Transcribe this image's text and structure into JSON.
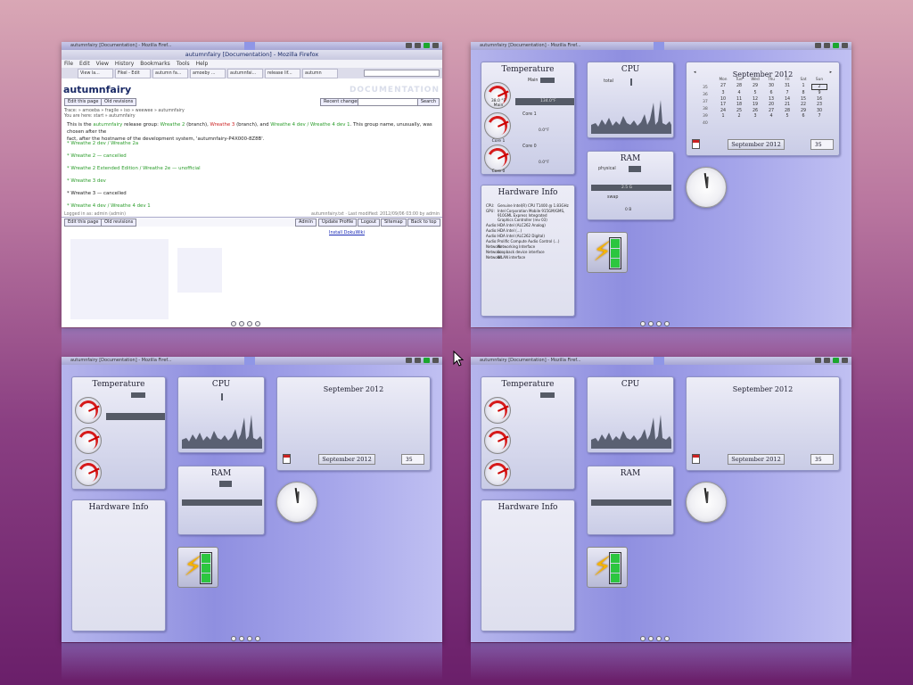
{
  "firefox": {
    "panel_title": "autumnfairy [Documentation] - Mozilla Firef...",
    "window_title": "autumnfairy [Documentation] - Mozilla Firefox",
    "menu": [
      "File",
      "Edit",
      "View",
      "History",
      "Bookmarks",
      "Tools",
      "Help"
    ],
    "tabs": [
      "View la...",
      "Fikel - Edit",
      "autumn fa...",
      "amoeby ...",
      "autumnfai...",
      "release lif...",
      "autumn"
    ],
    "logo": "autumnfairy",
    "doc_label": "DOCUMENTATION",
    "buttons": {
      "edit_page": "Edit this page",
      "old_revisions": "Old revisions",
      "recent_changes": "Recent changes",
      "search": "Search"
    },
    "trail": "Trace: » amoeba » fragile » iso » weewee » autumnfairy",
    "location": "You are here: start » autumnfairy",
    "intro_prefix": "This is the",
    "intro_link": "autumnfairy",
    "intro_mid": "release group:",
    "g1": "Wreathe 2",
    "g1_tail": "(branch),",
    "g2": "Wreathe 3",
    "g2_tail": "(branch), and",
    "g3": "Wreathe 4 dev / Wreathe 4 dev 1",
    "intro_end": ". This group name, unusually, was chosen after the",
    "intro_line2": "fact, after the hostname of the development system, 'autumnfairy-P4X000-8Z8B'.",
    "bullets": [
      "Wreathe 2 dev / Wreathe 2a",
      "Wreathe 2 — cancelled",
      "Wreathe 2 Extended Edition / Wreathe 2e — unofficial",
      "Wreathe 3 dev",
      "Wreathe 3 — cancelled",
      "Wreathe 4 dev / Wreathe 4 dev 1"
    ],
    "footer_left": "Logged in as: admin (admin)",
    "footer_right": "autumnfairy.txt · Last modified: 2012/09/06 03:00 by admin",
    "footer_buttons": [
      "Admin",
      "Update Profile",
      "Logout",
      "Sitemap",
      "Back to top"
    ],
    "footer_edit": "Edit this page",
    "footer_old": "Old revisions",
    "install": "Install DokuWiki"
  },
  "desktop": {
    "panel_title": "autumnfairy [Documentation] - Mozilla Firef...",
    "temperature": {
      "title": "Temperature",
      "main_label": "Main",
      "core1_label": "Core 1",
      "core0_label": "Core 0",
      "gauge1_value": "38.0 °F",
      "gauge1_label": "Main",
      "gauge2_label": "Core 1",
      "gauge3_label": "Core 0",
      "reading_main": "134.0°F",
      "reading_core1": "0.0°F",
      "reading_core0": "0.0°F"
    },
    "cpu": {
      "title": "CPU",
      "label": "total"
    },
    "ram": {
      "title": "RAM",
      "physical": "physical",
      "swap": "swap",
      "phys_value": "2.5 G",
      "swap_value": "0 B"
    },
    "hardware": {
      "title": "Hardware Info",
      "rows": [
        [
          "CPU:",
          "Genuine Intel(R) CPU T1400 @ 1.83GHz"
        ],
        [
          "GPU:",
          "Intel Corporation Mobile 915GM/GMS,"
        ],
        [
          "",
          "910GML Express Integrated"
        ],
        [
          "",
          "Graphics Controller (rev 03)"
        ],
        [
          "Audio:",
          "HDA Intel (ALC262 Analog)"
        ],
        [
          "Audio:",
          "HDA Intel (...)"
        ],
        [
          "Audio:",
          "HDA Intel (ALC262 Digital)"
        ],
        [
          "Audio:",
          "Prolific Compute Audio Control (...)"
        ],
        [
          "Network:",
          "Networking Interface"
        ],
        [
          "Network:",
          "Loopback device interface"
        ],
        [
          "Network:",
          "WLAN interface"
        ]
      ]
    },
    "calendar": {
      "month_title": "September 2012",
      "headers": [
        "Mon",
        "Tue",
        "Wed",
        "Thu",
        "Fri",
        "Sat",
        "Sun"
      ],
      "weeks": [
        "35",
        "36",
        "37",
        "38",
        "39",
        "40"
      ],
      "days": [
        [
          "27",
          "28",
          "29",
          "30",
          "31",
          "1",
          "2"
        ],
        [
          "3",
          "4",
          "5",
          "6",
          "7",
          "8",
          "9"
        ],
        [
          "10",
          "11",
          "12",
          "13",
          "14",
          "15",
          "16"
        ],
        [
          "17",
          "18",
          "19",
          "20",
          "21",
          "22",
          "23"
        ],
        [
          "24",
          "25",
          "26",
          "27",
          "28",
          "29",
          "30"
        ],
        [
          "1",
          "2",
          "3",
          "4",
          "5",
          "6",
          "7"
        ]
      ],
      "selected_day": "2",
      "month_box": "September 2012",
      "week_box": "35"
    },
    "battery_level": 1.0
  },
  "colors": {
    "accent": "#8f92e0",
    "link_green": "#2a9c2a",
    "link_red": "#cc2222"
  }
}
